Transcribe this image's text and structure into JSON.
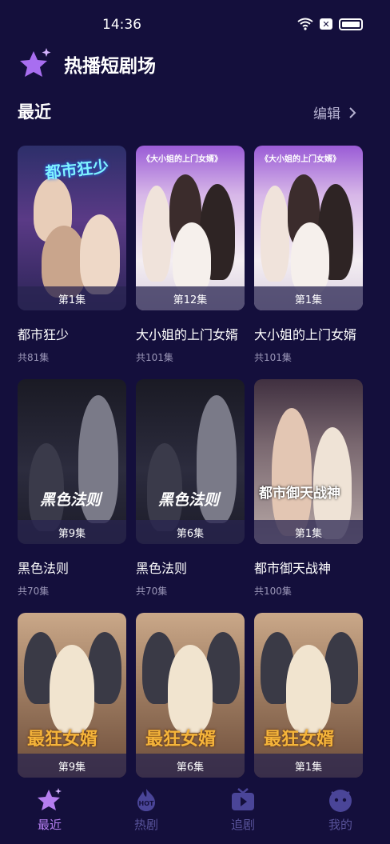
{
  "status": {
    "time": "14:36",
    "icons": [
      "wifi-icon",
      "sim-x-icon",
      "battery-icon"
    ]
  },
  "app": {
    "title": "热播短剧场",
    "logo_icon": "star-sparkle-icon"
  },
  "recent": {
    "title": "最近",
    "edit_label": "编辑"
  },
  "cards": [
    {
      "title": "都市狂少",
      "episodes_total": "共81集",
      "episode_badge": "第1集",
      "poster_text": "都市狂少",
      "theme": "city"
    },
    {
      "title": "大小姐的上门女婿",
      "episodes_total": "共101集",
      "episode_badge": "第12集",
      "poster_text": "《大小姐的上门女婿》",
      "theme": "miss"
    },
    {
      "title": "大小姐的上门女婿",
      "episodes_total": "共101集",
      "episode_badge": "第1集",
      "poster_text": "《大小姐的上门女婿》",
      "theme": "miss"
    },
    {
      "title": "黑色法则",
      "episodes_total": "共70集",
      "episode_badge": "第9集",
      "poster_text": "黑色法则",
      "theme": "black"
    },
    {
      "title": "黑色法则",
      "episodes_total": "共70集",
      "episode_badge": "第6集",
      "poster_text": "黑色法则",
      "theme": "black"
    },
    {
      "title": "都市御天战神",
      "episodes_total": "共100集",
      "episode_badge": "第1集",
      "poster_text": "都市御天战神",
      "theme": "war"
    },
    {
      "title": "",
      "episodes_total": "",
      "episode_badge": "第9集",
      "poster_text": "最狂女婿",
      "theme": "rich"
    },
    {
      "title": "",
      "episodes_total": "",
      "episode_badge": "第6集",
      "poster_text": "最狂女婿",
      "theme": "rich"
    },
    {
      "title": "",
      "episodes_total": "",
      "episode_badge": "第1集",
      "poster_text": "最狂女婿",
      "theme": "rich"
    }
  ],
  "nav": [
    {
      "label": "最近",
      "icon": "star-icon",
      "active": true
    },
    {
      "label": "热剧",
      "icon": "hot-flame-icon",
      "active": false
    },
    {
      "label": "追剧",
      "icon": "play-tv-icon",
      "active": false
    },
    {
      "label": "我的",
      "icon": "profile-face-icon",
      "active": false
    }
  ],
  "colors": {
    "background": "#140f3c",
    "accent": "#b57ef0",
    "nav_inactive": "#58539a",
    "muted_text": "#9b97b8"
  }
}
